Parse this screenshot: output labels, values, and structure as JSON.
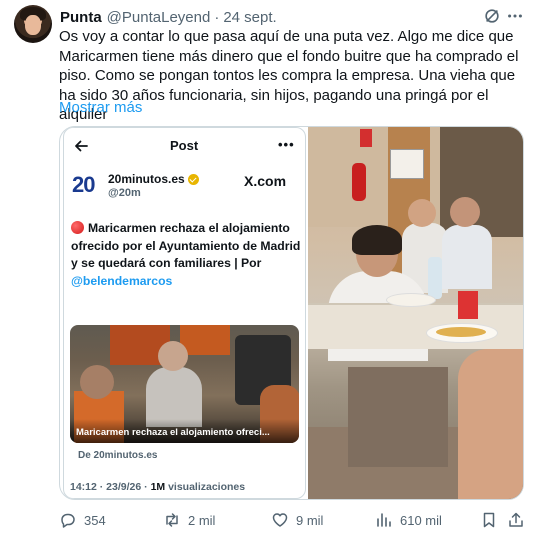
{
  "tweet": {
    "author_name": "Punta",
    "author_handle": "@PuntaLeyend",
    "separator": "·",
    "date": "24 sept.",
    "text": "Os voy a contar lo que pasa aquí de una puta vez. Algo me dice que Maricarmen tiene más dinero que el fondo buitre que ha comprado el piso. Como se pongan tontos les compra la empresa. Una vieha que ha sido 30 años funcionaria, sin hijos, pagando una pringá por el alquiler",
    "show_more": "Mostrar más"
  },
  "embedded": {
    "title": "Post",
    "more": "•••",
    "logo": "20",
    "account_name": "20minutos.es",
    "account_handle": "@20m",
    "site": "X.com",
    "headline": "Maricarmen rechaza el alojamiento ofrecido por el Ayuntamiento de Madrid y se quedará con familiares | Por ",
    "headline_mention": "@belendemarcos",
    "image_caption": "Maricarmen rechaza el alojamiento ofreci...",
    "source": "De 20minutos.es",
    "timestamp": "14:12 · 23/9/26 · ",
    "views_count": "1M",
    "views_label": " visualizaciones"
  },
  "actions": {
    "replies": "354",
    "reposts": "2 mil",
    "likes": "9 mil",
    "views": "610 mil"
  },
  "icons": [
    "grok-icon",
    "more-icon",
    "reply-icon",
    "repost-icon",
    "like-icon",
    "views-icon",
    "bookmark-icon",
    "share-icon",
    "back-arrow-icon",
    "verified-badge-icon"
  ]
}
